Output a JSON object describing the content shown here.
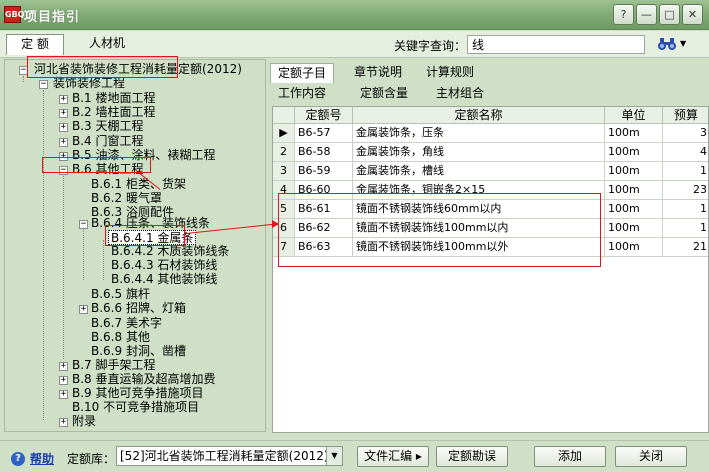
{
  "window": {
    "title": "项目指引",
    "app_icon_text": "GBQ"
  },
  "tabs": [
    {
      "label": "定 额"
    },
    {
      "label": "人材机"
    }
  ],
  "search": {
    "label": "关键字查询：",
    "value": "线"
  },
  "tree": {
    "root": "河北省装饰装修工程消耗量定额(2012)",
    "level1": "装饰装修工程",
    "b1": "B.1 楼地面工程",
    "b2": "B.2 墙柱面工程",
    "b3": "B.3 天棚工程",
    "b4": "B.4 门窗工程",
    "b5": "B.5 油漆、涂料、裱糊工程",
    "b6": "B.6 其他工程",
    "b61": "B.6.1 柜类、货架",
    "b62": "B.6.2 暖气罩",
    "b63": "B.6.3 浴厕配件",
    "b64": "B.6.4 压条、装饰线条",
    "b641": "B.6.4.1 金属条",
    "b642": "B.6.4.2 木质装饰线条",
    "b643": "B.6.4.3 石材装饰线",
    "b644": "B.6.4.4 其他装饰线",
    "b65": "B.6.5 旗杆",
    "b66": "B.6.6 招牌、灯箱",
    "b67": "B.6.7 美术字",
    "b68": "B.6.8 其他",
    "b69": "B.6.9 封洞、凿槽",
    "b7": "B.7 脚手架工程",
    "b8": "B.8 垂直运输及超高增加费",
    "b9": "B.9 其他可竞争措施项目",
    "b10": "B.10 不可竞争措施项目",
    "appendix": "附录"
  },
  "subtabs": {
    "row1": [
      "定额子目",
      "章节说明",
      "计算规则"
    ],
    "row2": [
      "工作内容",
      "定额含量",
      "主材组合"
    ]
  },
  "table": {
    "headers": [
      "定额号",
      "定额名称",
      "单位",
      "预算"
    ],
    "rows": [
      {
        "n": "",
        "code": "B6-57",
        "name": "金属装饰条，压条",
        "unit": "100m",
        "price": "3"
      },
      {
        "n": "2",
        "code": "B6-58",
        "name": "金属装饰条，角线",
        "unit": "100m",
        "price": "4"
      },
      {
        "n": "3",
        "code": "B6-59",
        "name": "金属装饰条，槽线",
        "unit": "100m",
        "price": "1"
      },
      {
        "n": "4",
        "code": "B6-60",
        "name": "金属装饰条，铜嵌条2×15",
        "unit": "100m",
        "price": "23"
      },
      {
        "n": "5",
        "code": "B6-61",
        "name": "镜面不锈钢装饰线60mm以内",
        "unit": "100m",
        "price": "1"
      },
      {
        "n": "6",
        "code": "B6-62",
        "name": "镜面不锈钢装饰线100mm以内",
        "unit": "100m",
        "price": "1"
      },
      {
        "n": "7",
        "code": "B6-63",
        "name": "镜面不锈钢装饰线100mm以外",
        "unit": "100m",
        "price": "21"
      }
    ]
  },
  "footer": {
    "help": "帮助",
    "lib_label": "定额库：",
    "lib_value": "[52]河北省装饰工程消耗量定额(2012)",
    "btn_summary": "文件汇编",
    "btn_errata": "定额勘误",
    "btn_add": "添加",
    "btn_close": "关闭"
  },
  "window_controls": {
    "help": "?",
    "minimize": "—",
    "maximize": "□",
    "close": "✕"
  },
  "icons": {
    "expand": "+",
    "collapse": "−",
    "row_marker": "▶",
    "dropdown": "▼",
    "binoculars": "🔭",
    "help": "?",
    "arrow_right": "▸"
  },
  "colors": {
    "title_bg": "#7ea874",
    "panel_bg": "#cfe0c6",
    "annotation_red": "#e2131a",
    "link_blue": "#1b3fb0"
  }
}
